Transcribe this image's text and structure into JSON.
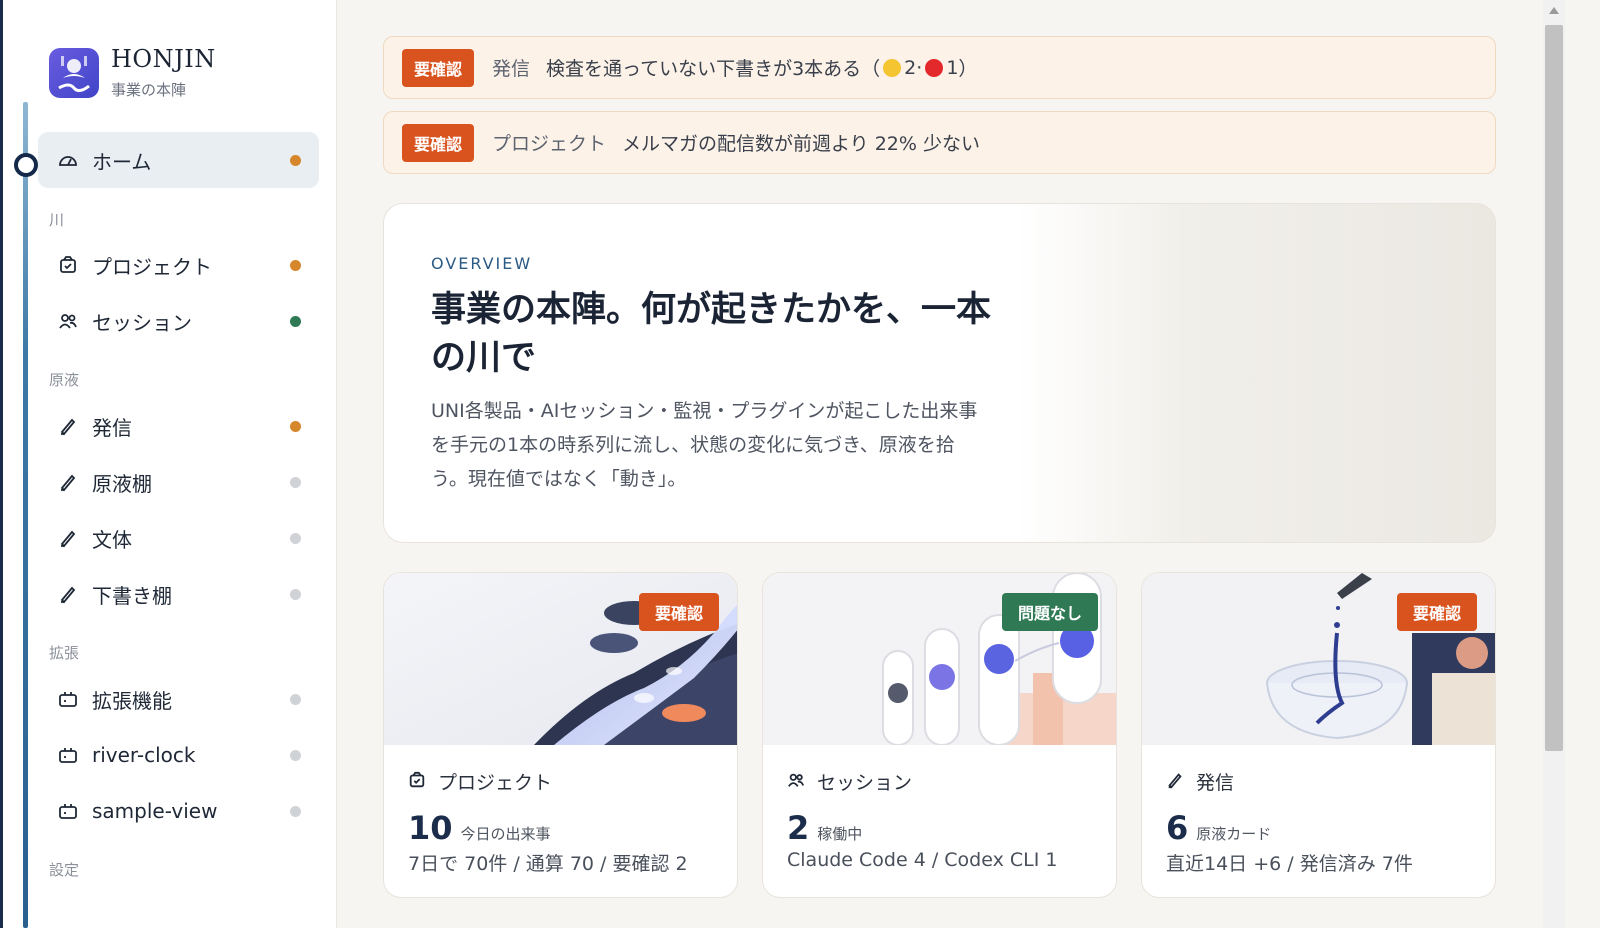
{
  "brand": {
    "name": "HONJIN",
    "subtitle": "事業の本陣"
  },
  "sidebar": {
    "home": {
      "label": "ホーム",
      "icon": "dashboard-icon",
      "dot": "#d6862b"
    },
    "sections": {
      "river": "川",
      "stock": "原液",
      "extensions": "拡張",
      "settings": "設定"
    },
    "items": [
      {
        "label": "プロジェクト",
        "icon": "project-icon",
        "dot": "#d6862b"
      },
      {
        "label": "セッション",
        "icon": "users-icon",
        "dot": "#2f7a55"
      },
      {
        "label": "発信",
        "icon": "pen-icon",
        "dot": "#d6862b"
      },
      {
        "label": "原液棚",
        "icon": "pen-icon",
        "dot": "#cfd2d6"
      },
      {
        "label": "文体",
        "icon": "pen-icon",
        "dot": "#cfd2d6"
      },
      {
        "label": "下書き棚",
        "icon": "pen-icon",
        "dot": "#cfd2d6"
      },
      {
        "label": "拡張機能",
        "icon": "plugin-icon",
        "dot": "#cfd2d6"
      },
      {
        "label": "river-clock",
        "icon": "plugin-icon",
        "dot": "#cfd2d6"
      },
      {
        "label": "sample-view",
        "icon": "plugin-icon",
        "dot": "#cfd2d6"
      }
    ]
  },
  "alerts": [
    {
      "badge": "要確認",
      "category": "発信",
      "text_before": "検査を通っていない下書きが3本ある（",
      "yellow_count": "2",
      "separator": "·",
      "red_count": "1",
      "text_after": "）"
    },
    {
      "badge": "要確認",
      "category": "プロジェクト",
      "text": "メルマガの配信数が前週より 22% 少ない"
    }
  ],
  "hero": {
    "kicker": "OVERVIEW",
    "title": "事業の本陣。何が起きたかを、一本の川で",
    "description": "UNI各製品・AIセッション・監視・プラグインが起こした出来事を手元の1本の時系列に流し、状態の変化に気づき、原液を拾う。現在値ではなく「動き」。"
  },
  "cards": [
    {
      "badge": "要確認",
      "badge_color": "#d9531e",
      "title": "プロジェクト",
      "number": "10",
      "unit": "今日の出来事",
      "sub": "7日で 70件 / 通算 70 / 要確認 2"
    },
    {
      "badge": "問題なし",
      "badge_color": "#2f7a55",
      "title": "セッション",
      "number": "2",
      "unit": "稼働中",
      "sub": "Claude Code 4 / Codex CLI 1"
    },
    {
      "badge": "要確認",
      "badge_color": "#d9531e",
      "title": "発信",
      "number": "6",
      "unit": "原液カード",
      "sub": "直近14日 +6 / 発信済み 7件"
    }
  ],
  "colors": {
    "accent_navy": "#1b2d4b",
    "alert_orange": "#d9531e",
    "ok_green": "#2f7a55",
    "warn_yellow": "#f5c431",
    "err_red": "#e3292b"
  }
}
